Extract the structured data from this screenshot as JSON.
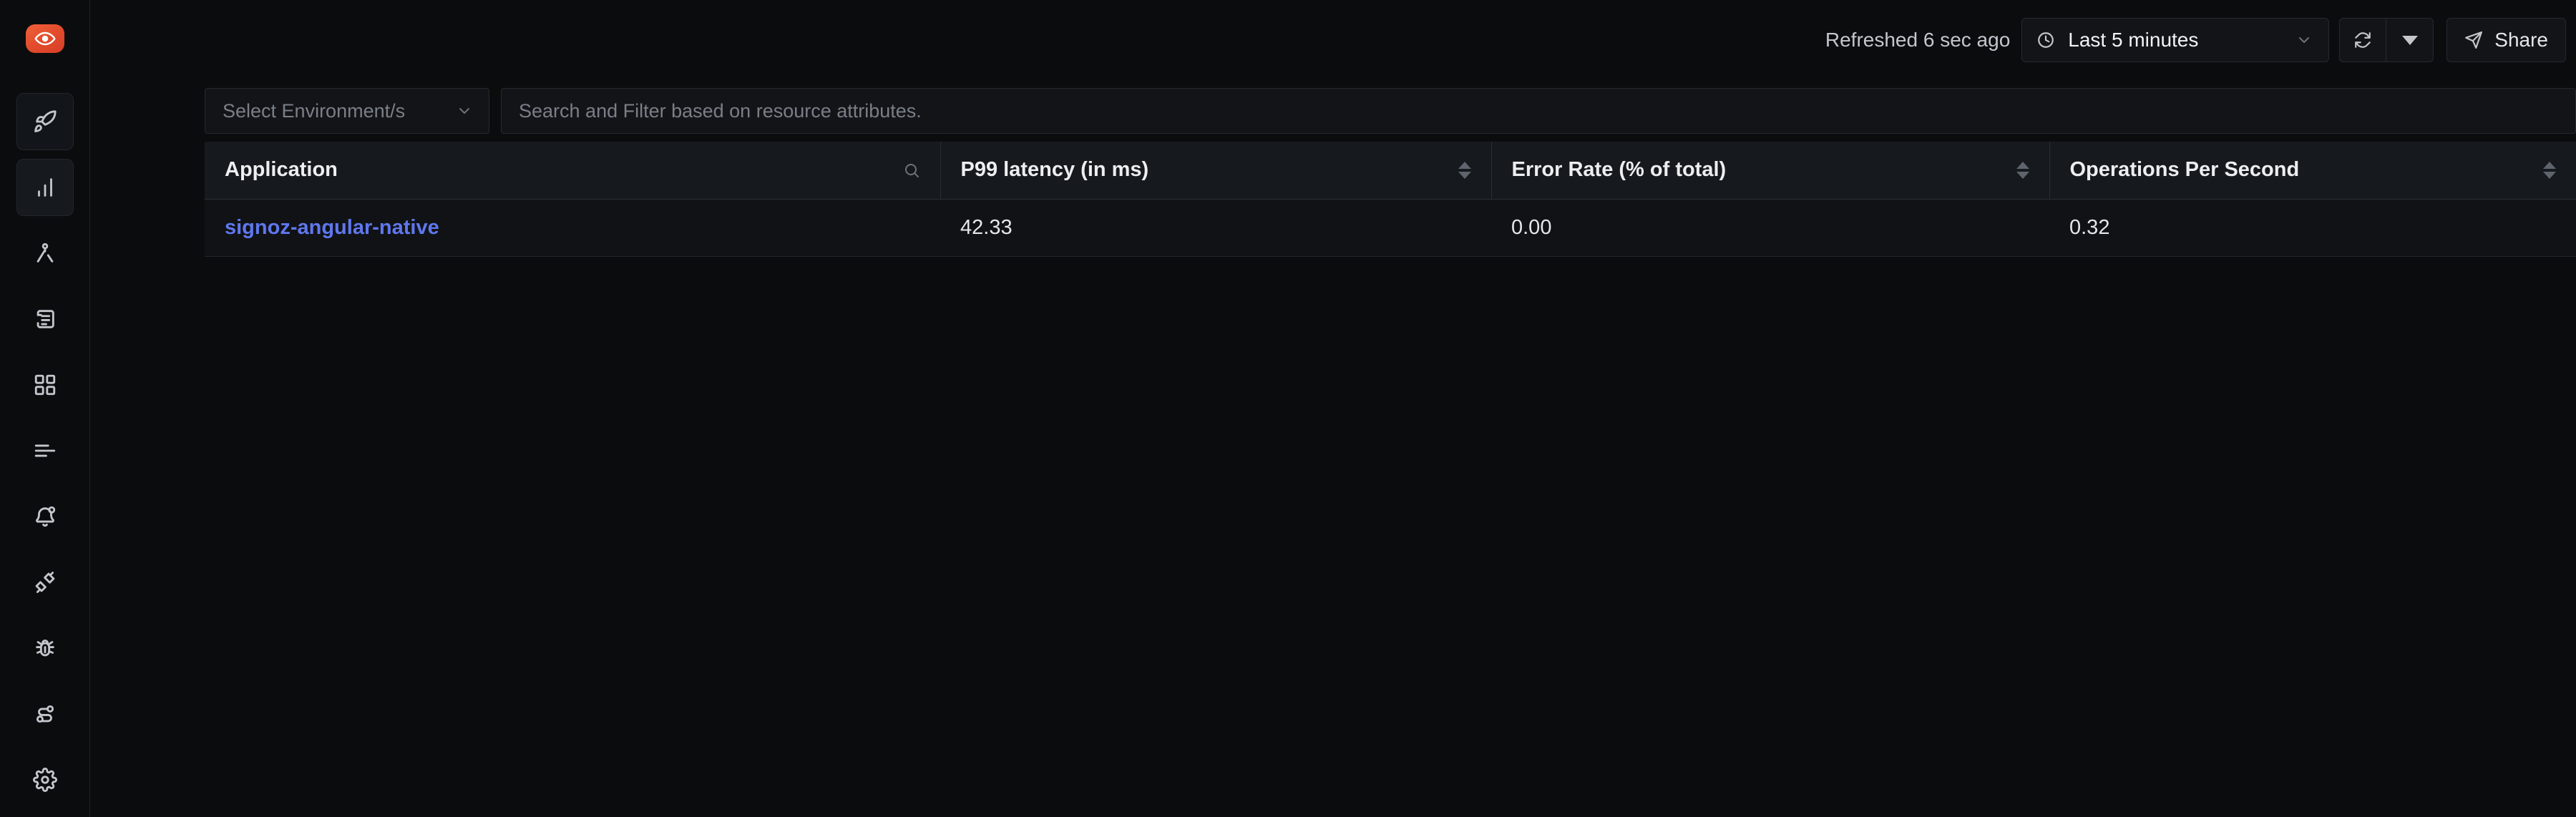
{
  "app": {
    "logo_icon": "signoz-eye-logo",
    "brand_color": "#e14a2b"
  },
  "sidebar": {
    "items": [
      {
        "icon": "rocket-icon",
        "name": "get-started",
        "active": false,
        "boxed": true
      },
      {
        "icon": "bar-chart-icon",
        "name": "services",
        "active": true,
        "boxed": true
      },
      {
        "icon": "compass-icon",
        "name": "traces",
        "active": false,
        "boxed": false
      },
      {
        "icon": "scroll-icon",
        "name": "logs",
        "active": false,
        "boxed": false
      },
      {
        "icon": "grid-icon",
        "name": "dashboards",
        "active": false,
        "boxed": false
      },
      {
        "icon": "align-left-icon",
        "name": "exceptions",
        "active": false,
        "boxed": false
      },
      {
        "icon": "bell-dot-icon",
        "name": "alerts",
        "active": false,
        "boxed": false
      },
      {
        "icon": "unplug-icon",
        "name": "integrations",
        "active": false,
        "boxed": false
      },
      {
        "icon": "bug-icon",
        "name": "errors",
        "active": false,
        "boxed": false
      },
      {
        "icon": "route-icon",
        "name": "pipelines",
        "active": false,
        "boxed": false
      },
      {
        "icon": "gear-icon",
        "name": "settings",
        "active": false,
        "boxed": false
      }
    ]
  },
  "topbar": {
    "refreshed_text": "Refreshed 6 sec ago",
    "time_range": "Last 5 minutes",
    "clock_icon": "clock-icon",
    "chevron_icon": "chevron-down-icon",
    "refresh_icon": "refresh-icon",
    "refresh_dropdown_icon": "caret-down-icon",
    "share_label": "Share",
    "share_icon": "send-icon"
  },
  "filters": {
    "environment_placeholder": "Select Environment/s",
    "environment_value": "",
    "search_placeholder": "Search and Filter based on resource attributes.",
    "search_value": ""
  },
  "table": {
    "columns": [
      {
        "label": "Application",
        "sortable": false,
        "searchable": true
      },
      {
        "label": "P99 latency (in ms)",
        "sortable": true,
        "searchable": false
      },
      {
        "label": "Error Rate (% of total)",
        "sortable": true,
        "searchable": false
      },
      {
        "label": "Operations Per Second",
        "sortable": true,
        "searchable": false
      }
    ],
    "rows": [
      {
        "application": "signoz-angular-native",
        "p99_latency": "42.33",
        "error_rate": "0.00",
        "operations_per_second": "0.32"
      }
    ]
  }
}
